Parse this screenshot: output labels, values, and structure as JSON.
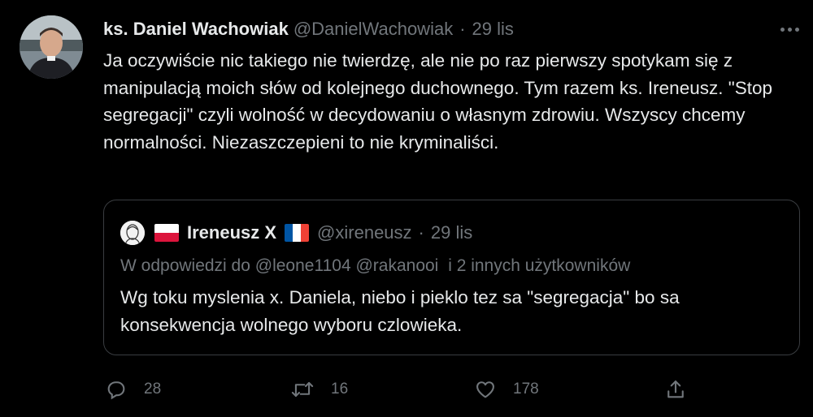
{
  "tweet": {
    "author": {
      "display_name": "ks. Daniel Wachowiak",
      "handle": "@DanielWachowiak",
      "separator": "·",
      "date": "29 lis"
    },
    "text": "Ja oczywiście nic takiego nie twierdzę, ale nie po raz pierwszy spotykam się z manipulacją moich słów od kolejnego duchownego. Tym razem ks. Ireneusz. \"Stop segregacji\" czyli wolność w decydowaniu o własnym zdrowiu. Wszyscy chcemy normalności. Niezaszczepieni to nie kryminaliści.",
    "quote": {
      "display_name": "Ireneusz X",
      "handle": "@xireneusz",
      "separator": "·",
      "date": "29 lis",
      "reply_prefix": "W odpowiedzi do",
      "reply_mention_1": "@leone1104",
      "reply_mention_2": "@rakanooi",
      "reply_suffix": "i 2 innych użytkowników",
      "text": "Wg toku myslenia x. Daniela, niebo i pieklo tez sa \"segregacja\" bo sa konsekwencja wolnego wyboru czlowieka."
    },
    "actions": {
      "reply_count": "28",
      "retweet_count": "16",
      "like_count": "178"
    }
  },
  "icons": {
    "more": "more-horizontal-icon",
    "reply": "reply-bubble-icon",
    "retweet": "retweet-icon",
    "like": "heart-icon",
    "share": "share-icon",
    "flag_left": "poland-flag-icon",
    "flag_right": "france-flag-icon"
  },
  "colors": {
    "background": "#000000",
    "primary_text": "#e7e9ea",
    "secondary_text": "#71767b",
    "border": "#3a3d41"
  }
}
